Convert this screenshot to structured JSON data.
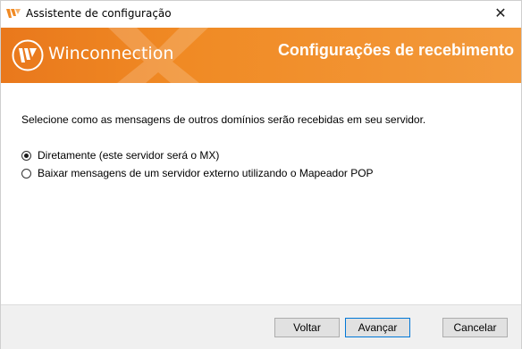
{
  "window": {
    "title": "Assistente de configuração",
    "close_glyph": "✕"
  },
  "banner": {
    "brand": "Winconnection",
    "heading": "Configurações de recebimento",
    "accent_color": "#f08a24",
    "logo_icon": "winconnection-logo-icon"
  },
  "content": {
    "prompt": "Selecione como as mensagens de outros domínios serão recebidas em seu servidor.",
    "options": [
      {
        "label": "Diretamente (este servidor será o MX)",
        "selected": true
      },
      {
        "label": "Baixar mensagens de um servidor externo utilizando o Mapeador POP",
        "selected": false
      }
    ]
  },
  "footer": {
    "back_label": "Voltar",
    "next_label": "Avançar",
    "cancel_label": "Cancelar"
  }
}
